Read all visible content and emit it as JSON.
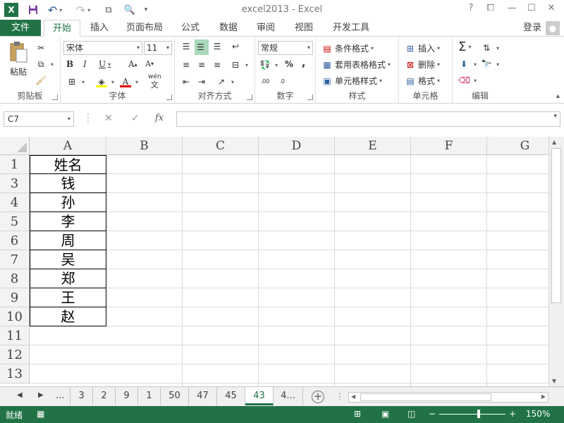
{
  "app": {
    "title": "excel2013 - Excel",
    "help": "?",
    "login": "登录"
  },
  "quick_access": {
    "excel_logo": "X",
    "save": "💾",
    "undo": "↶",
    "redo": "↷"
  },
  "tabs": [
    {
      "label": "文件"
    },
    {
      "label": "开始"
    },
    {
      "label": "插入"
    },
    {
      "label": "页面布局"
    },
    {
      "label": "公式"
    },
    {
      "label": "数据"
    },
    {
      "label": "审阅"
    },
    {
      "label": "视图"
    },
    {
      "label": "开发工具"
    }
  ],
  "ribbon": {
    "clipboard": {
      "label": "剪贴板",
      "paste": "粘贴"
    },
    "font": {
      "label": "字体",
      "font_name": "宋体",
      "font_size": "11",
      "bold": "B",
      "italic": "I",
      "underline": "U",
      "grow": "A",
      "shrink": "A",
      "font_color": "A",
      "phonetic_top": "wén",
      "phonetic_bottom": "文"
    },
    "alignment": {
      "label": "对齐方式"
    },
    "number": {
      "label": "数字",
      "format": "常规",
      "percent": "%",
      "comma": ","
    },
    "styles": {
      "label": "样式",
      "conditional": "条件格式",
      "table": "套用表格格式",
      "cell_styles": "单元格样式"
    },
    "cells": {
      "label": "单元格",
      "insert": "插入",
      "delete": "删除",
      "format": "格式"
    },
    "editing": {
      "label": "编辑",
      "sum": "Σ"
    }
  },
  "formula_bar": {
    "name_box": "C7",
    "fx": "fx",
    "cancel": "✕",
    "enter": "✓",
    "value": ""
  },
  "grid": {
    "columns": [
      "A",
      "B",
      "C",
      "D",
      "E",
      "F",
      "G"
    ],
    "rows": [
      {
        "num": "1",
        "a": "姓名"
      },
      {
        "num": "3",
        "a": "钱"
      },
      {
        "num": "4",
        "a": "孙"
      },
      {
        "num": "5",
        "a": "李"
      },
      {
        "num": "6",
        "a": "周"
      },
      {
        "num": "7",
        "a": "吴"
      },
      {
        "num": "8",
        "a": "郑"
      },
      {
        "num": "9",
        "a": "王"
      },
      {
        "num": "10",
        "a": "赵"
      },
      {
        "num": "11",
        "a": ""
      },
      {
        "num": "12",
        "a": ""
      },
      {
        "num": "13",
        "a": ""
      }
    ]
  },
  "sheets": {
    "ellipsis": "...",
    "tabs": [
      "3",
      "2",
      "9",
      "1",
      "50",
      "47",
      "45",
      "43",
      "4..."
    ],
    "active": "43",
    "more": "⋮"
  },
  "status": {
    "text": "就绪",
    "zoom": "150%"
  }
}
